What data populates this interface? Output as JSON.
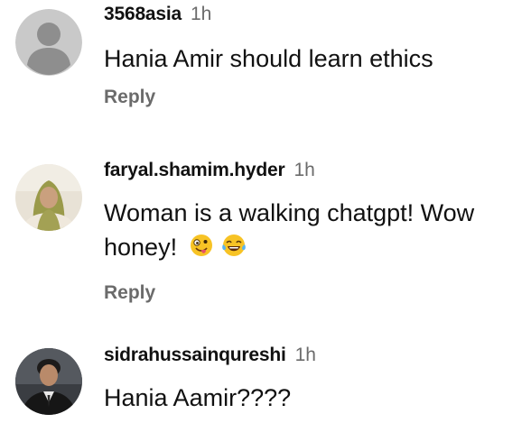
{
  "comments": [
    {
      "username": "3568asia",
      "time": "1h",
      "text": "Hania Amir should learn ethics",
      "reply_label": "Reply",
      "avatar": "default-person-icon"
    },
    {
      "username": "faryal.shamim.hyder",
      "time": "1h",
      "text_line1": "Woman is a walking chatgpt! Wow",
      "text_line2": "honey!",
      "emojis": [
        "zany-face-emoji",
        "tears-of-joy-emoji"
      ],
      "reply_label": "Reply",
      "avatar": "user-photo-avatar"
    },
    {
      "username": "sidrahussainqureshi",
      "time": "1h",
      "text": "Hania Aamir????",
      "avatar": "user-photo-avatar"
    }
  ],
  "colors": {
    "text": "#111111",
    "muted": "#6b6b6b",
    "default_avatar_bg": "#c9c9c9",
    "default_avatar_fg": "#8e8e8e"
  }
}
